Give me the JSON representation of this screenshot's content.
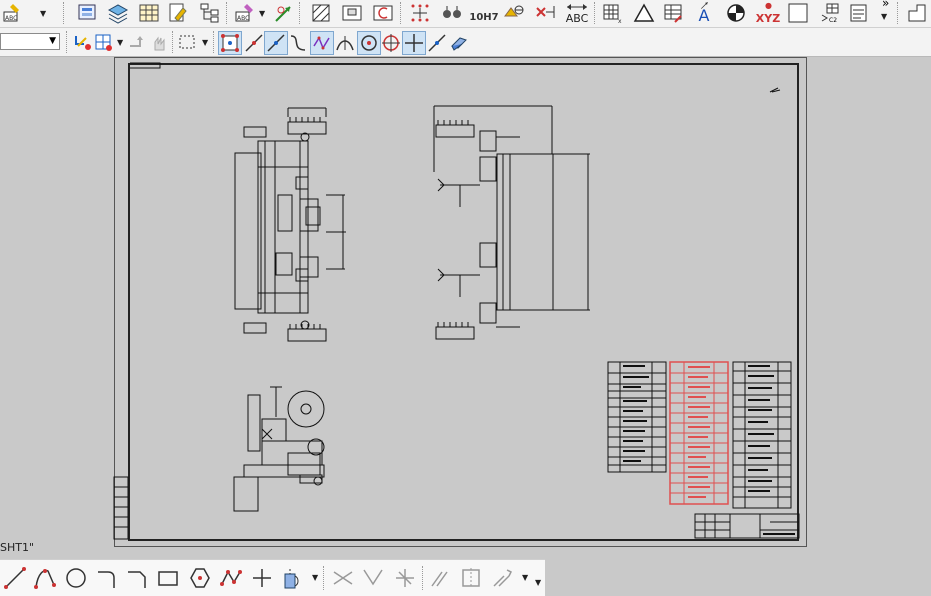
{
  "sheet": {
    "name": "SHT1\""
  },
  "toolbar": {
    "text_btn_tol": "10H7",
    "text_btn_abc": "ABC",
    "text_btn_xyz": "XYZ",
    "text_btn_a": "A",
    "text_btn_chevrons": "»"
  },
  "drawing": {
    "note_text": "ref"
  },
  "colors": {
    "toolbar_bg": "#f3f3f3",
    "canvas_bg": "#c9c9c9",
    "line": "#111111",
    "highlight": "#e05050",
    "accent_red": "#e03030",
    "toggle_blue": "#cfe3f5"
  }
}
